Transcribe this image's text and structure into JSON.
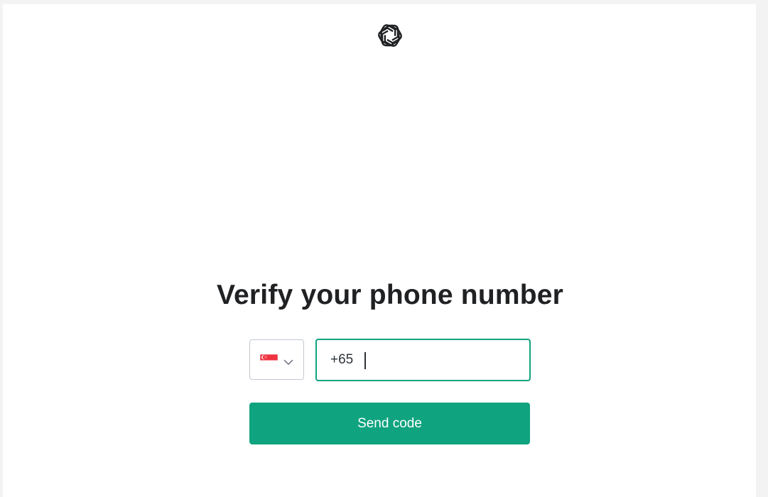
{
  "header": {
    "logo_icon": "openai-logo-icon"
  },
  "main": {
    "title": "Verify your phone number",
    "country_select": {
      "selected_country_flag": "singapore-flag-icon",
      "chevron_icon": "chevron-down-icon"
    },
    "phone_input": {
      "dial_code": "+65",
      "value": ""
    },
    "send_button_label": "Send code"
  },
  "colors": {
    "accent": "#10a37f",
    "title_text": "#202123",
    "input_border": "#c2c8d0",
    "flag_red": "#ef3340",
    "flag_white": "#ffffff"
  }
}
